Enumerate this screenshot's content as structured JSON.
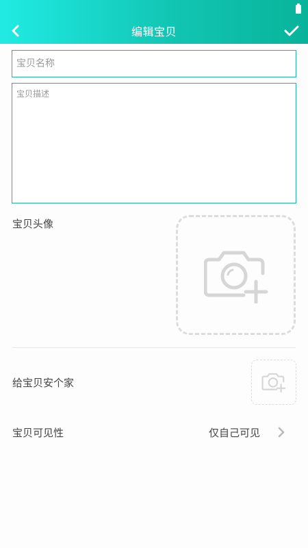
{
  "header": {
    "title": "编辑宝贝"
  },
  "form": {
    "name_placeholder": "宝贝名称",
    "description_placeholder": "宝贝描述",
    "avatar_label": "宝贝头像",
    "home_label": "给宝贝安个家",
    "visibility_label": "宝贝可见性",
    "visibility_value": "仅自己可见"
  },
  "icons": {
    "back": "chevron-left-icon",
    "confirm": "check-icon",
    "avatar_upload": "camera-plus-icon",
    "home_upload": "camera-plus-icon",
    "visibility_arrow": "chevron-right-icon",
    "battery": "battery-icon"
  },
  "colors": {
    "header_start": "#20ebe3",
    "header_end": "#08b39a",
    "input_border": "#1cb3a6",
    "dashed_border": "#dcdcdc",
    "icon_gray": "#d6d6d6"
  }
}
